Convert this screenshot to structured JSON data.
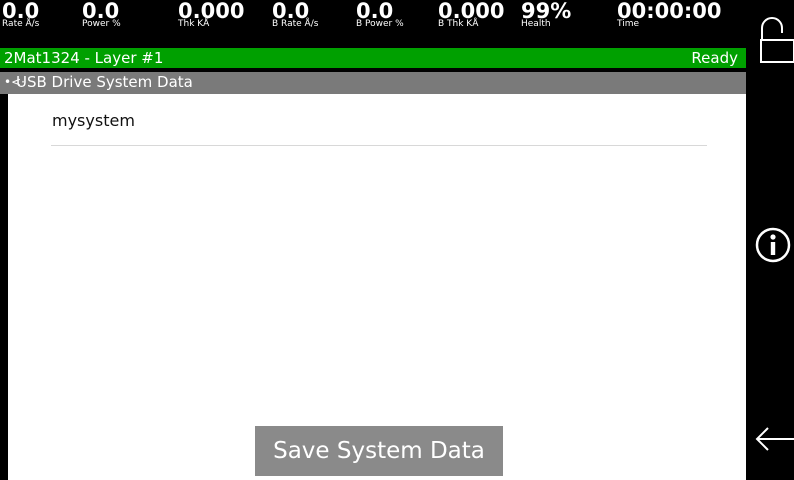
{
  "metrics": [
    {
      "value": "0.0",
      "label": "Rate Å/s"
    },
    {
      "value": "0.0",
      "label": "Power %"
    },
    {
      "value": "0.000",
      "label": "Thk KÅ"
    },
    {
      "value": "0.0",
      "label": "B Rate Å/s"
    },
    {
      "value": "0.0",
      "label": "B Power %"
    },
    {
      "value": "0.000",
      "label": "B Thk KÅ"
    },
    {
      "value": "99%",
      "label": "Health"
    },
    {
      "value": "00:00:00",
      "label": "Time"
    }
  ],
  "status": {
    "left": "2Mat1324 - Layer #1",
    "right": "Ready"
  },
  "panel": {
    "title": "USB Drive System Data",
    "items": [
      "mysystem"
    ]
  },
  "save_button": "Save System Data",
  "sidebar_icons": [
    "unlock-icon",
    "info-icon",
    "back-arrow-icon"
  ],
  "colors": {
    "status_bar": "#00a000",
    "title_bar": "#7a7a7a",
    "button": "#8a8a8a"
  }
}
